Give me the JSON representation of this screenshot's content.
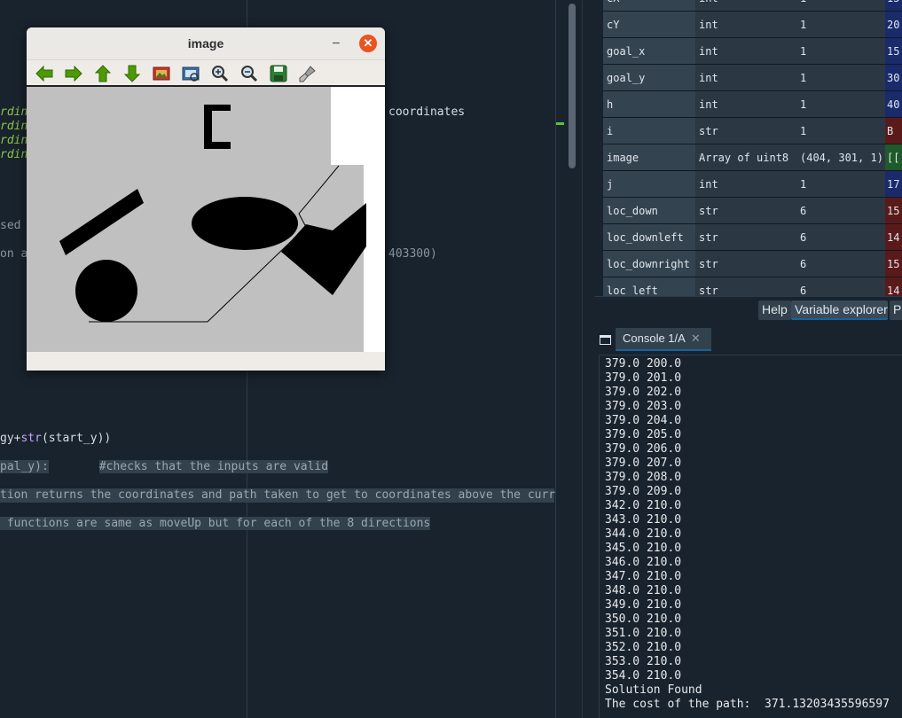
{
  "editor": {
    "fragments": {
      "rdinc1": "rdinc",
      "coordinates": "coordinates",
      "rdinc2": "rdinc",
      "rdinc3": "rdinc",
      "rdinc4": "rdinc",
      "sed": "sed t",
      "on_as": "on as",
      "num403300": "403300)",
      "gy_plus": "gy+",
      "str_kw": "str",
      "start_y": "(start_y))",
      "pal_y": "pal_y):",
      "checks_comment": "#checks that the inputs are valid",
      "tion_returns": "tion returns the coordinates and path taken to get to coordinates above the current",
      "functions_same": " functions are same as moveUp but for each of the 8 directions"
    }
  },
  "image_window": {
    "title": "image",
    "minimize_glyph": "–",
    "close_glyph": "✕",
    "toolbar": [
      "pan-left",
      "pan-right",
      "pan-up",
      "pan-down",
      "reset-zoom",
      "zoom-region",
      "zoom-in",
      "zoom-out",
      "save-image",
      "edit-properties"
    ]
  },
  "variable_explorer": {
    "rows": [
      {
        "name": "cX",
        "type": "int",
        "size": "1",
        "value": "15"
      },
      {
        "name": "cY",
        "type": "int",
        "size": "1",
        "value": "20"
      },
      {
        "name": "goal_x",
        "type": "int",
        "size": "1",
        "value": "15"
      },
      {
        "name": "goal_y",
        "type": "int",
        "size": "1",
        "value": "30"
      },
      {
        "name": "h",
        "type": "int",
        "size": "1",
        "value": "40"
      },
      {
        "name": "i",
        "type": "str",
        "size": "1",
        "value": "B"
      },
      {
        "name": "image",
        "type": "Array of uint8",
        "size": "(404, 301, 1)",
        "value": "[["
      },
      {
        "name": "j",
        "type": "int",
        "size": "1",
        "value": "17"
      },
      {
        "name": "loc_down",
        "type": "str",
        "size": "6",
        "value": "15"
      },
      {
        "name": "loc_downleft",
        "type": "str",
        "size": "6",
        "value": "14"
      },
      {
        "name": "loc_downright",
        "type": "str",
        "size": "6",
        "value": "15"
      },
      {
        "name": "loc_left",
        "type": "str",
        "size": "6",
        "value": "14"
      }
    ],
    "value_colors": [
      "#1a2a6b",
      "#1a2a6b",
      "#1a2a6b",
      "#1a2a6b",
      "#1a2a6b",
      "#5a1a1a",
      "#1e5a2a",
      "#1a2a6b",
      "#5a1a1a",
      "#5a1a1a",
      "#5a1a1a",
      "#5a1a1a"
    ]
  },
  "pane_tabs": {
    "help": "Help",
    "variable_explorer": "Variable explorer",
    "plots": "P"
  },
  "console": {
    "tab_label": "Console 1/A",
    "close_glyph": "✕",
    "lines": [
      "379.0 200.0",
      "379.0 201.0",
      "379.0 202.0",
      "379.0 203.0",
      "379.0 204.0",
      "379.0 205.0",
      "379.0 206.0",
      "379.0 207.0",
      "379.0 208.0",
      "379.0 209.0",
      "342.0 210.0",
      "343.0 210.0",
      "344.0 210.0",
      "345.0 210.0",
      "346.0 210.0",
      "347.0 210.0",
      "348.0 210.0",
      "349.0 210.0",
      "350.0 210.0",
      "351.0 210.0",
      "352.0 210.0",
      "353.0 210.0",
      "354.0 210.0",
      "Solution Found",
      "The cost of the path:  371.13203435596597"
    ]
  }
}
